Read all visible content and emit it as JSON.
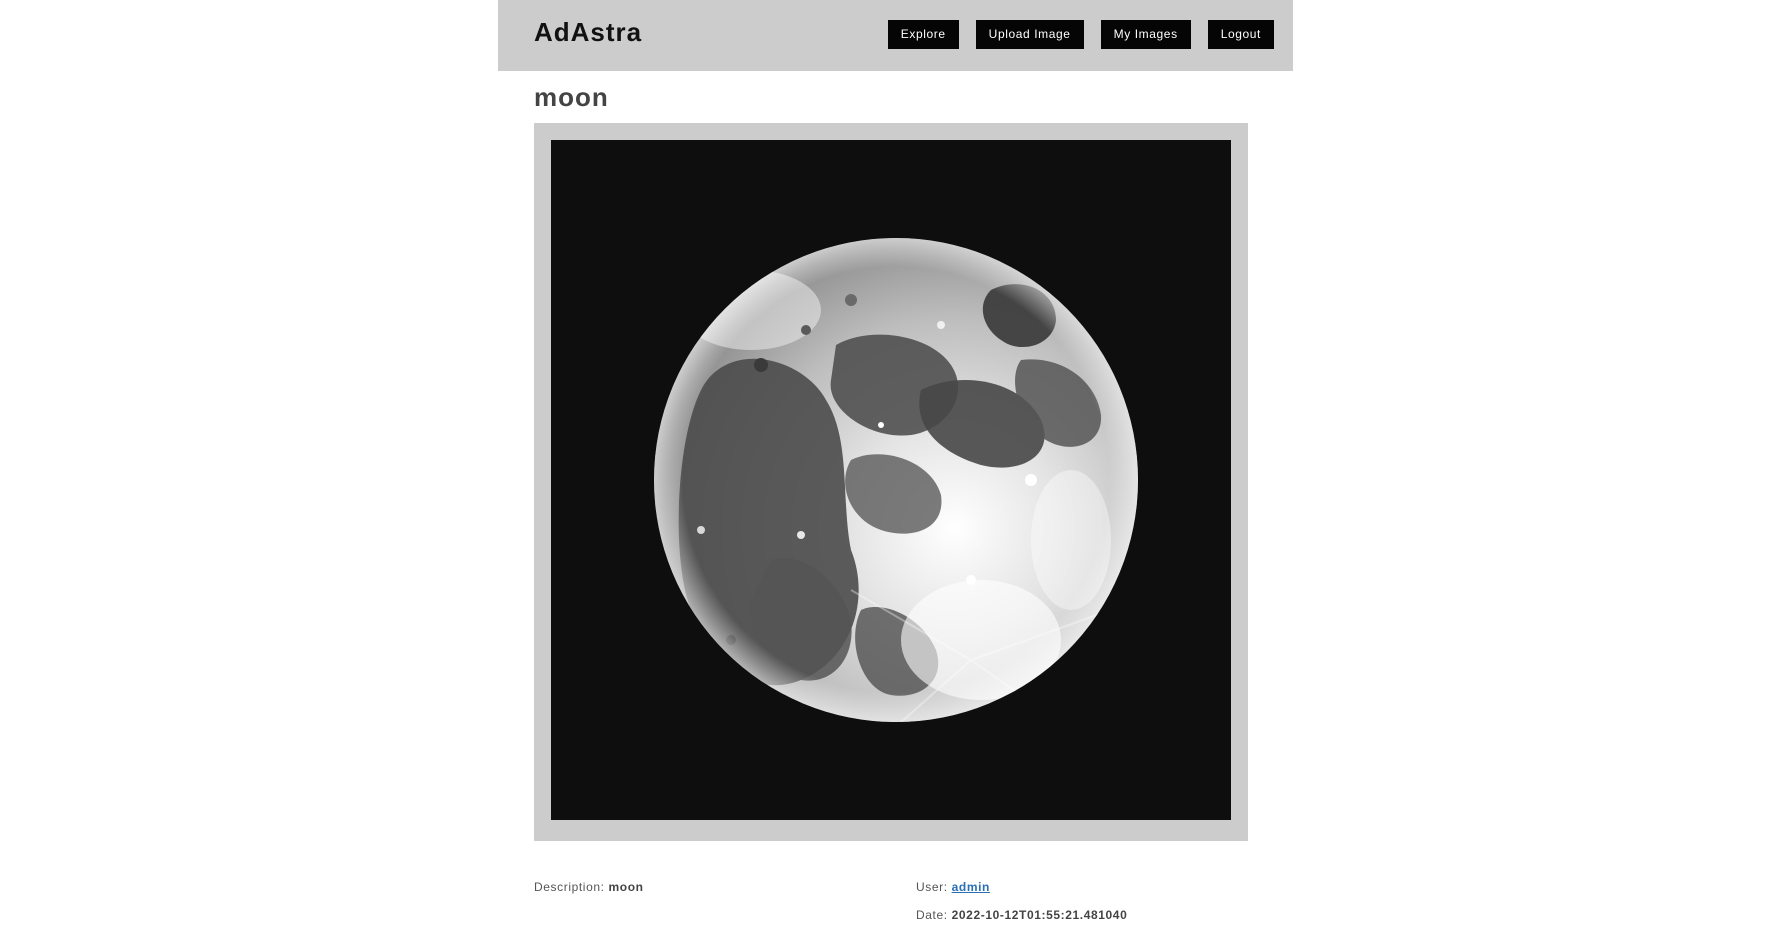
{
  "header": {
    "brand": "AdAstra",
    "nav": {
      "explore": "Explore",
      "upload": "Upload Image",
      "my_images": "My Images",
      "logout": "Logout"
    }
  },
  "image": {
    "title": "moon",
    "subject": "full-moon-photo"
  },
  "details": {
    "description_label": "Description:",
    "description_value": "moon",
    "user_label": "User:",
    "user_value": "admin",
    "date_label": "Date:",
    "date_value": "2022-10-12T01:55:21.481040"
  },
  "colors": {
    "header_bg": "#cccccc",
    "button_bg": "#050505",
    "link": "#2a6fb5"
  }
}
